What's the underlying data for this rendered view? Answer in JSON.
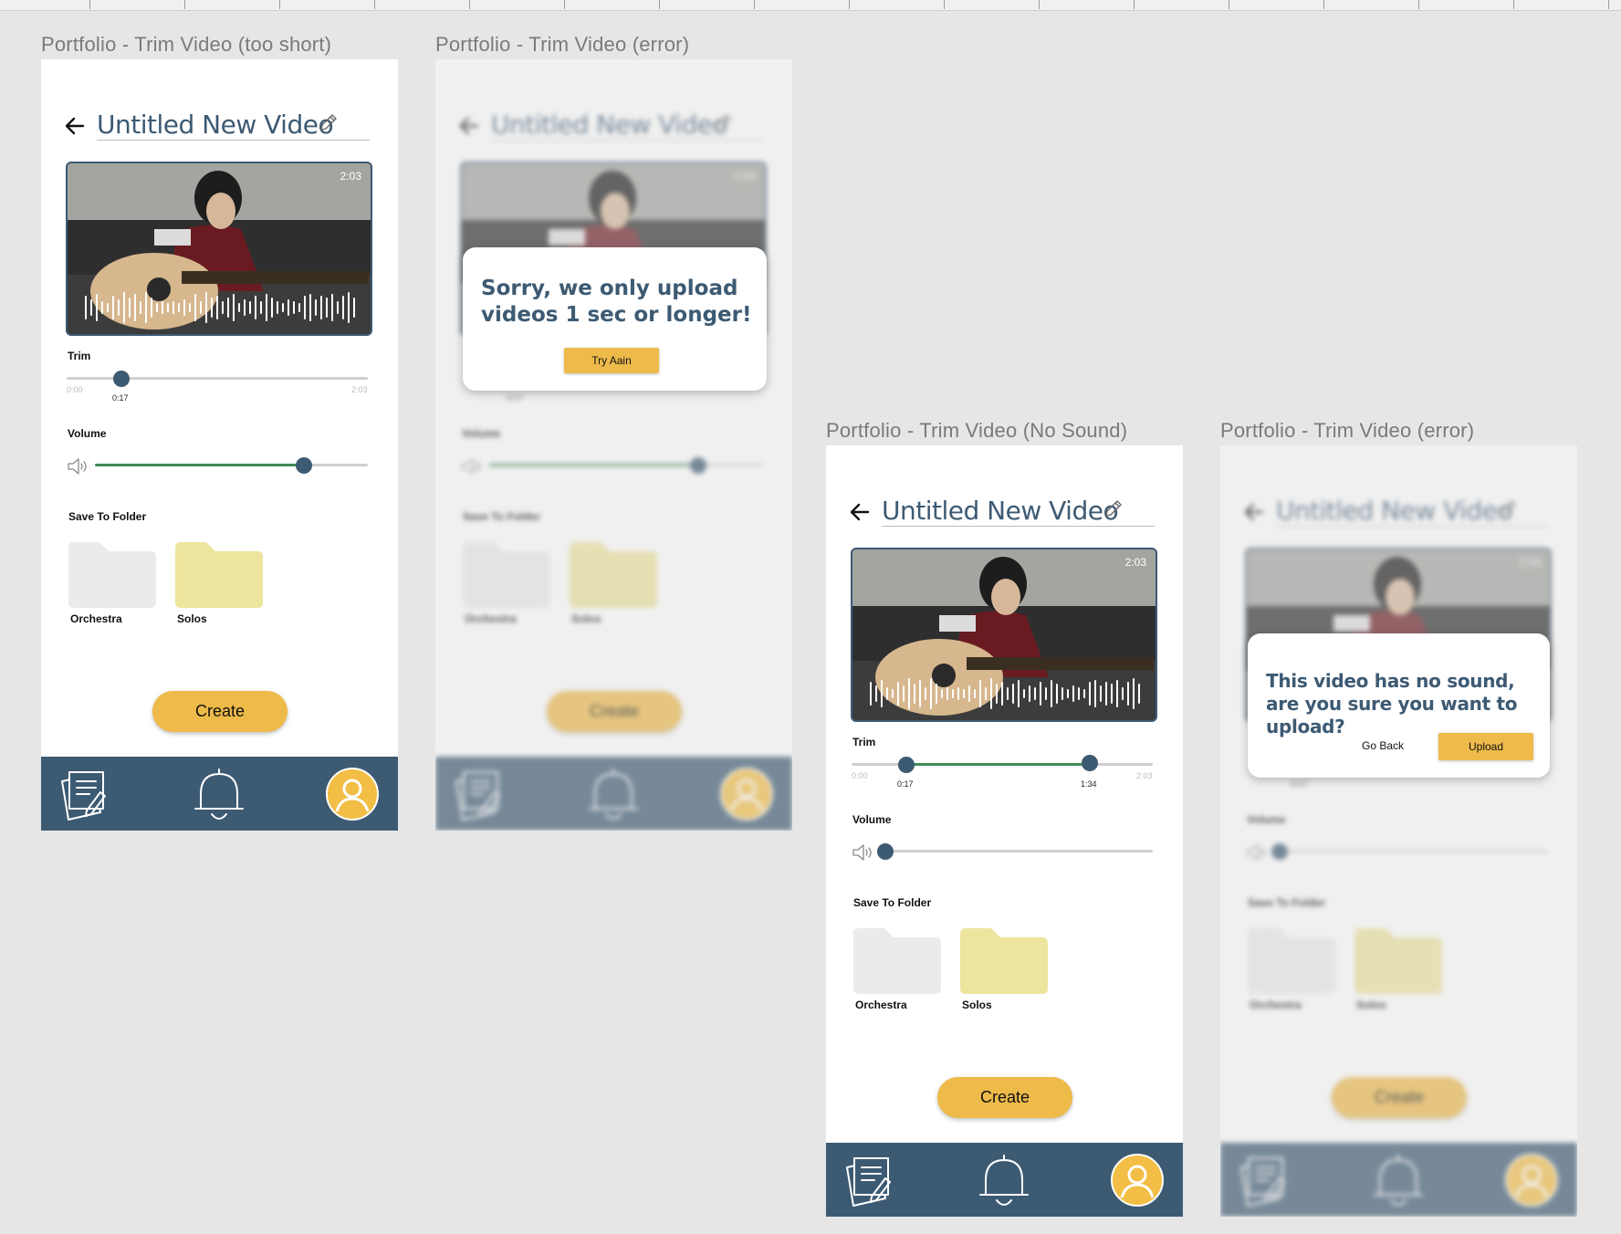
{
  "artboards": {
    "a1": {
      "label": "Portfolio - Trim Video (too short)"
    },
    "a2": {
      "label": "Portfolio - Trim Video (error)"
    },
    "a3": {
      "label": "Portfolio - Trim Video (No Sound)"
    },
    "a4": {
      "label": "Portfolio - Trim Video (error)"
    }
  },
  "screen": {
    "title": "Untitled New Video",
    "video_duration": "2:03",
    "trim_label": "Trim",
    "trim_start": "0:00",
    "trim_end": "2:03",
    "volume_label": "Volume",
    "folder_label": "Save To Folder",
    "folders": [
      "Orchestra",
      "Solos"
    ],
    "create_label": "Create"
  },
  "too_short": {
    "trim_handle": "0:17",
    "trim_position": 0.17,
    "volume_level": 0.73
  },
  "no_sound": {
    "trim_handle_start": "0:17",
    "trim_handle_end": "1:34",
    "trim_start_position": 0.17,
    "trim_end_position": 0.79,
    "volume_level": 0.0
  },
  "dialog_error": {
    "message": "Sorry, we only upload videos 1 sec or longer!",
    "button": "Try Aain"
  },
  "dialog_nosound": {
    "message": "This video has no sound, are you sure you want to upload?",
    "secondary": "Go Back",
    "primary": "Upload"
  },
  "colors": {
    "brand_blue": "#3d5a73",
    "accent_yellow": "#eeba4a",
    "slider_green": "#3f8a55",
    "folder_gray": "#ebebeb",
    "folder_yellow": "#ede49e"
  },
  "icons": [
    "back-arrow-icon",
    "pencil-icon",
    "speaker-icon",
    "folder-icon",
    "document-pen-icon",
    "bell-icon",
    "profile-icon"
  ]
}
